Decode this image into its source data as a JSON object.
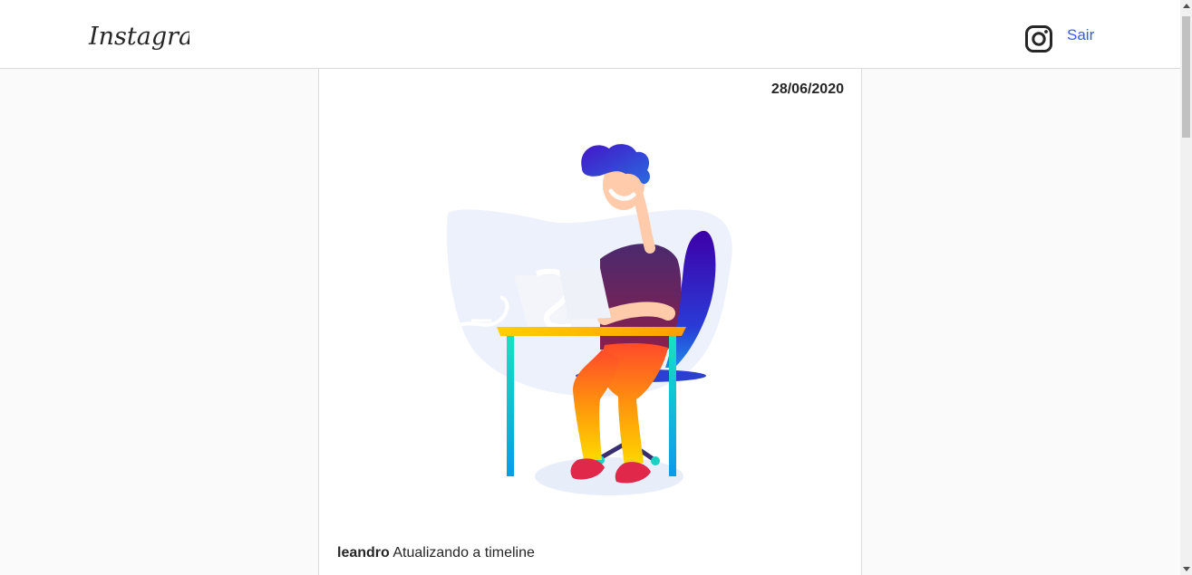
{
  "header": {
    "logo_text": "Instagram",
    "icon": "instagram-icon",
    "logout_label": "Sair",
    "link_color": "#3758f9"
  },
  "post": {
    "date": "28/06/2020",
    "username": "leandro",
    "caption": "Atualizando a timeline",
    "image": "person-working-at-laptop-illustration"
  }
}
